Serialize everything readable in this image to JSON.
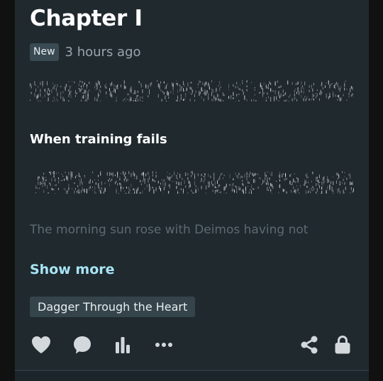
{
  "chapter": {
    "title": "Chapter I",
    "badge": "New",
    "timestamp": "3 hours ago",
    "heading": "When training fails",
    "excerpt": "The morning sun rose with Deimos having not",
    "show_more_label": "Show more",
    "tag": "Dagger Through the Heart"
  },
  "actions": {
    "like_icon": "heart-icon",
    "comment_icon": "comment-icon",
    "stats_icon": "bar-chart-icon",
    "more_icon": "ellipsis-icon",
    "share_icon": "share-icon",
    "lock_icon": "lock-icon"
  },
  "colors": {
    "card_bg": "#1f292e",
    "accent": "#a9e4f5",
    "icon": "#d2d8db"
  }
}
